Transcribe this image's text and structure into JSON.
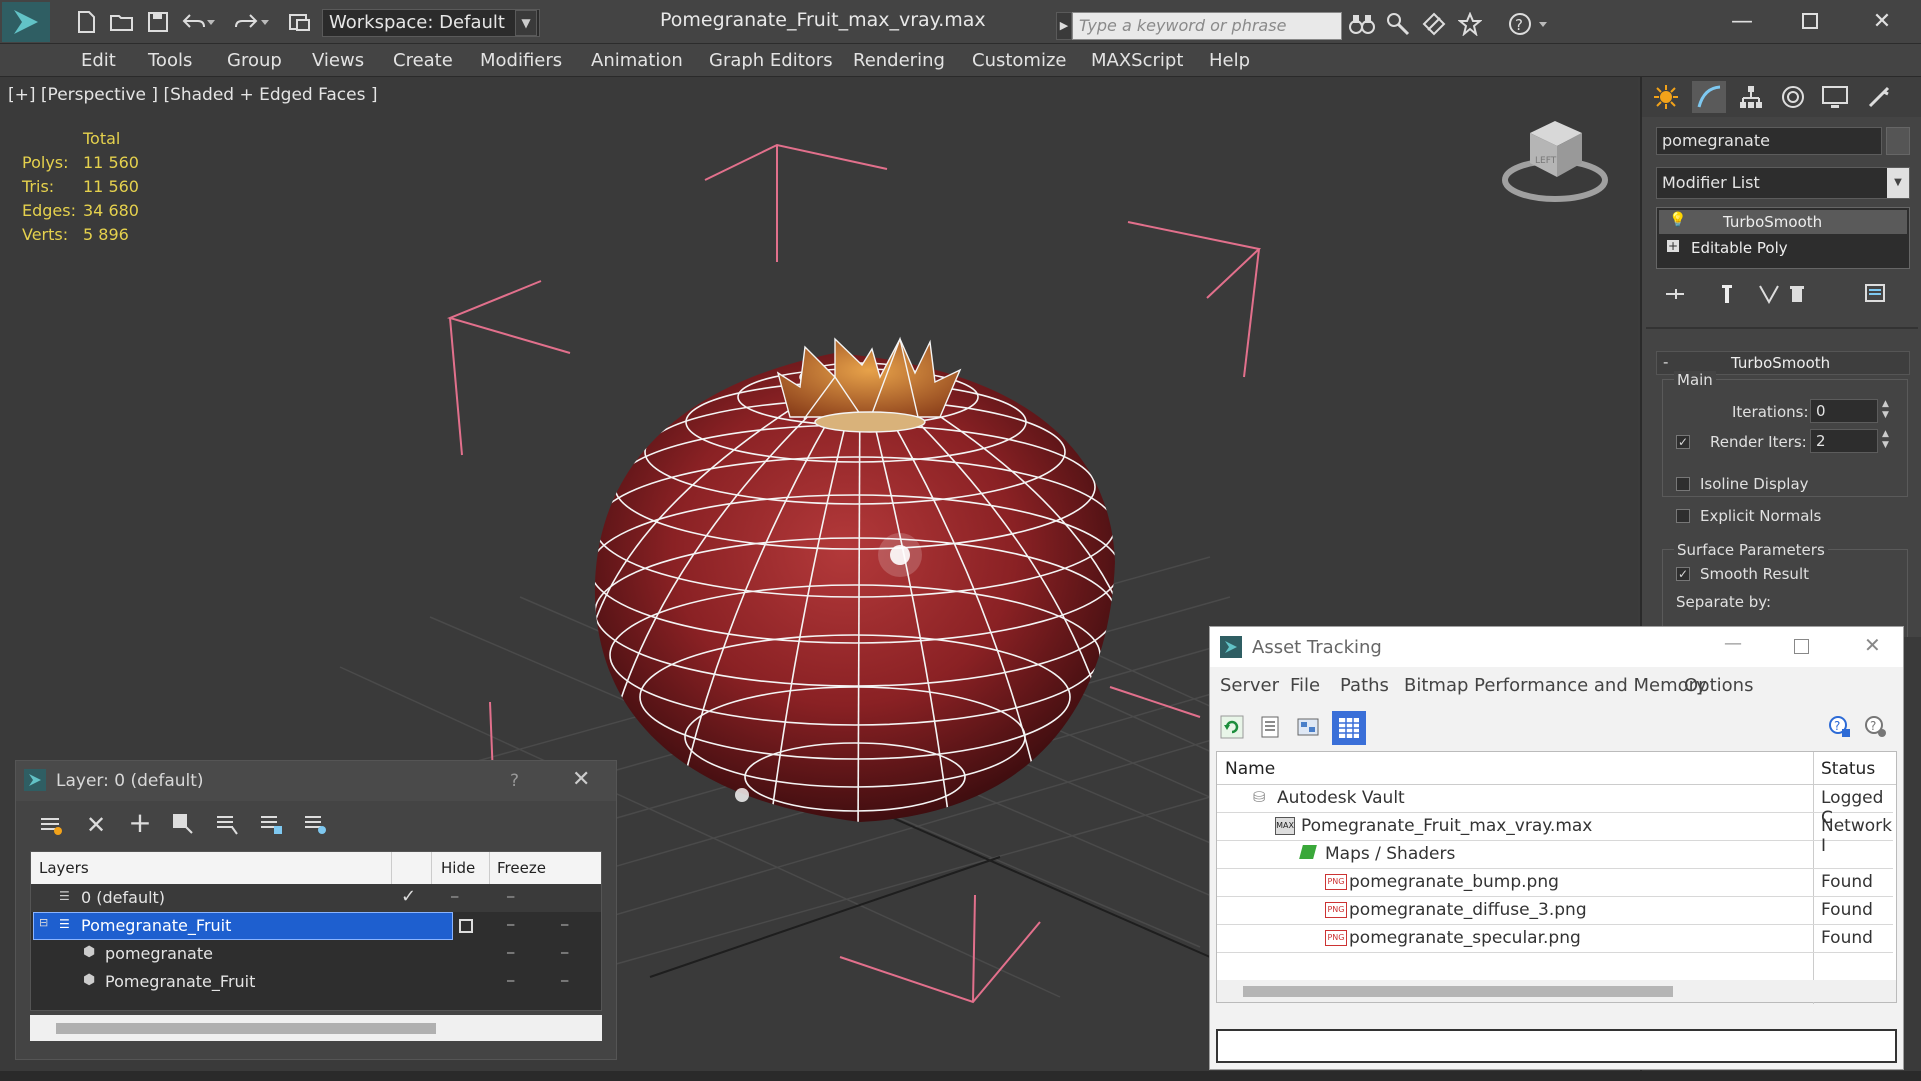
{
  "title_bar": {
    "workspace": "Workspace: Default",
    "document_title": "Pomegranate_Fruit_max_vray.max",
    "search_placeholder": "Type a keyword or phrase"
  },
  "menu": [
    "Edit",
    "Tools",
    "Group",
    "Views",
    "Create",
    "Modifiers",
    "Animation",
    "Graph Editors",
    "Rendering",
    "Customize",
    "MAXScript",
    "Help"
  ],
  "viewport": {
    "label": "[+] [Perspective ] [Shaded + Edged Faces ]",
    "stats_header": "Total",
    "stats": [
      {
        "label": "Polys:",
        "value": "11 560"
      },
      {
        "label": "Tris:",
        "value": "11 560"
      },
      {
        "label": "Edges:",
        "value": "34 680"
      },
      {
        "label": "Verts:",
        "value": "5 896"
      }
    ]
  },
  "command_panel": {
    "object_name": "pomegranate",
    "modifier_list": "Modifier List",
    "stack": [
      "TurboSmooth",
      "Editable Poly"
    ],
    "rollout_title": "TurboSmooth",
    "main_group": "Main",
    "iterations_label": "Iterations:",
    "iterations_value": "0",
    "render_iters_label": "Render Iters:",
    "render_iters_value": "2",
    "isoline_label": "Isoline Display",
    "explicit_normals_label": "Explicit Normals",
    "surface_params": "Surface Parameters",
    "smooth_result": "Smooth Result",
    "separate_by": "Separate by:"
  },
  "layer_window": {
    "title": "Layer: 0 (default)",
    "help": "?",
    "columns": {
      "layers": "Layers",
      "hide": "Hide",
      "freeze": "Freeze"
    },
    "rows": [
      {
        "name": "0 (default)"
      },
      {
        "name": "Pomegranate_Fruit"
      },
      {
        "name": "pomegranate"
      },
      {
        "name": "Pomegranate_Fruit"
      }
    ]
  },
  "asset_tracking": {
    "title": "Asset Tracking",
    "menu": [
      "Server",
      "File",
      "Paths",
      "Bitmap Performance and Memory",
      "Options"
    ],
    "columns": {
      "name": "Name",
      "status": "Status"
    },
    "rows": [
      {
        "name": "Autodesk Vault",
        "status": "Logged C"
      },
      {
        "name": "Pomegranate_Fruit_max_vray.max",
        "status": "Network I"
      },
      {
        "name": "Maps / Shaders",
        "status": ""
      },
      {
        "name": "pomegranate_bump.png",
        "status": "Found"
      },
      {
        "name": "pomegranate_diffuse_3.png",
        "status": "Found"
      },
      {
        "name": "pomegranate_specular.png",
        "status": "Found"
      }
    ]
  },
  "colors": {
    "accent": "#3a6fd8",
    "stats_yellow": "#e5d14d",
    "helper_pink": "#e2708c",
    "fruit_red": "#8e1f22"
  }
}
